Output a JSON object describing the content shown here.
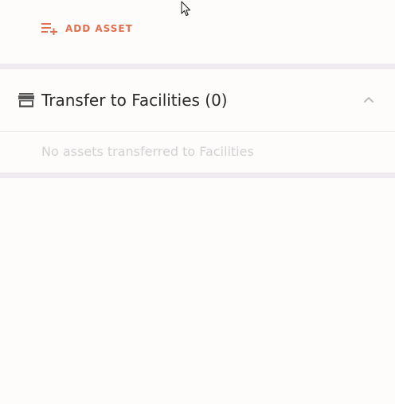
{
  "add_asset": {
    "label": "ADD ASSET",
    "icon": "playlist-add-icon",
    "color": "#e0704f"
  },
  "transfer_section": {
    "icon": "store-icon",
    "title": "Transfer to Facilities (0)",
    "empty_message": "No assets transferred to Facilities",
    "toggle_icon": "chevron-up-icon",
    "expanded": true
  },
  "colors": {
    "background": "#fdfcfb",
    "divider": "#efe9f0",
    "accent": "#e0704f",
    "title_text": "#2b2b2b",
    "muted_text": "#d3d0d3"
  }
}
